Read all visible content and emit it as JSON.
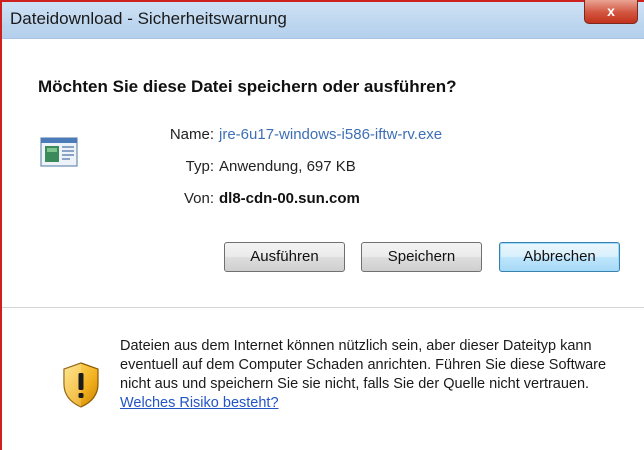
{
  "window": {
    "title": "Dateidownload - Sicherheitswarnung",
    "close_glyph": "x"
  },
  "dialog": {
    "question": "Möchten Sie diese Datei speichern oder ausführen?",
    "file_icon": "application-file-icon",
    "info": {
      "name_label": "Name:",
      "name_value": "jre-6u17-windows-i586-iftw-rv.exe",
      "type_label": "Typ:",
      "type_value": "Anwendung, 697 KB",
      "from_label": "Von:",
      "from_value": "dl8-cdn-00.sun.com"
    },
    "buttons": {
      "run": "Ausführen",
      "save": "Speichern",
      "cancel": "Abbrechen"
    }
  },
  "warning": {
    "icon": "security-shield-icon",
    "text": "Dateien aus dem Internet können nützlich sein, aber dieser Dateityp kann eventuell auf dem Computer Schaden anrichten. Führen Sie diese Software nicht aus und speichern Sie sie nicht, falls Sie der Quelle nicht vertrauen.",
    "link": "Welches Risiko besteht?"
  },
  "colors": {
    "link": "#3d6fb6",
    "warning_link": "#2255c4",
    "default_button_border": "#3c7fb1",
    "window_border": "#cf2020"
  }
}
